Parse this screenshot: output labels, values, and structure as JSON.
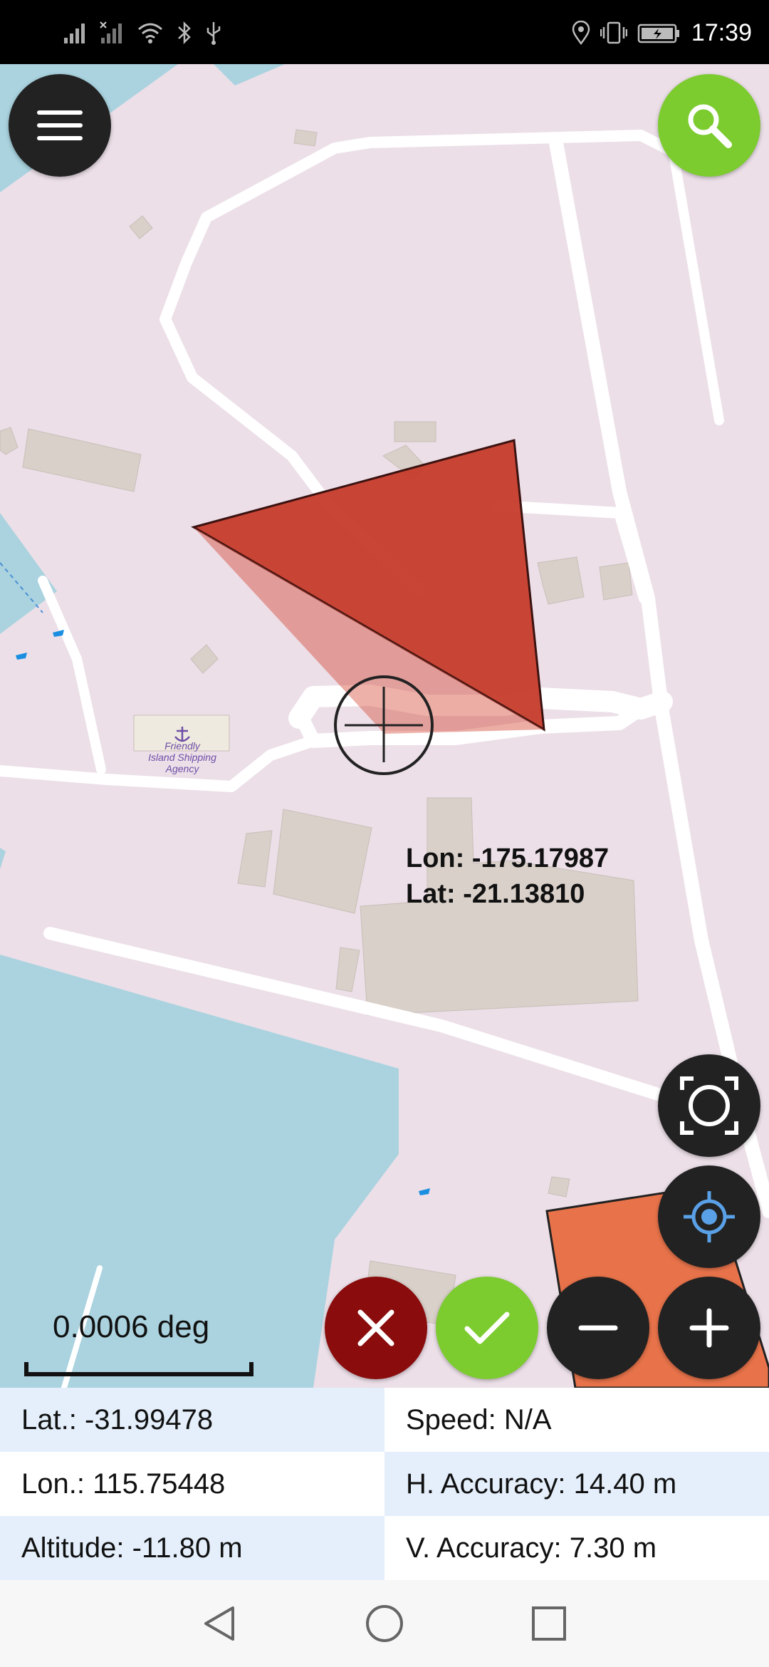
{
  "status_bar": {
    "time": "17:39",
    "left_icons": [
      "signal-icon",
      "signal-no-sim-icon",
      "wifi-icon",
      "bluetooth-icon",
      "usb-icon"
    ],
    "right_icons": [
      "location-icon",
      "vibrate-icon",
      "battery-charging-icon"
    ]
  },
  "map": {
    "poi_label": [
      "Friendly",
      "Island Shipping",
      "Agency"
    ],
    "crosshair_lon": "Lon: -175.17987",
    "crosshair_lat": "Lat: -21.13810",
    "scale_text": "0.0006 deg",
    "colors": {
      "land": "#ecdfe8",
      "water": "#aad3df",
      "road": "#ffffff",
      "building": "#d9d0c9",
      "polygon": "#c63b2b",
      "accent_green": "#7ccb2f",
      "cancel_red": "#8a0c0c",
      "dark_button": "#222222"
    }
  },
  "buttons": {
    "menu": "menu-icon",
    "search": "search-icon",
    "fit": "fit-screen-icon",
    "locate": "my-location-icon",
    "cancel": "close-icon",
    "confirm": "check-icon",
    "zoom_out": "minus-icon",
    "zoom_in": "plus-icon"
  },
  "info": {
    "lat": "Lat.: -31.99478",
    "speed": "Speed: N/A",
    "lon": "Lon.: 115.75448",
    "h_accuracy": "H. Accuracy: 14.40 m",
    "altitude": "Altitude: -11.80 m",
    "v_accuracy": "V. Accuracy: 7.30 m"
  },
  "nav": [
    "back-icon",
    "home-icon",
    "recents-icon"
  ]
}
